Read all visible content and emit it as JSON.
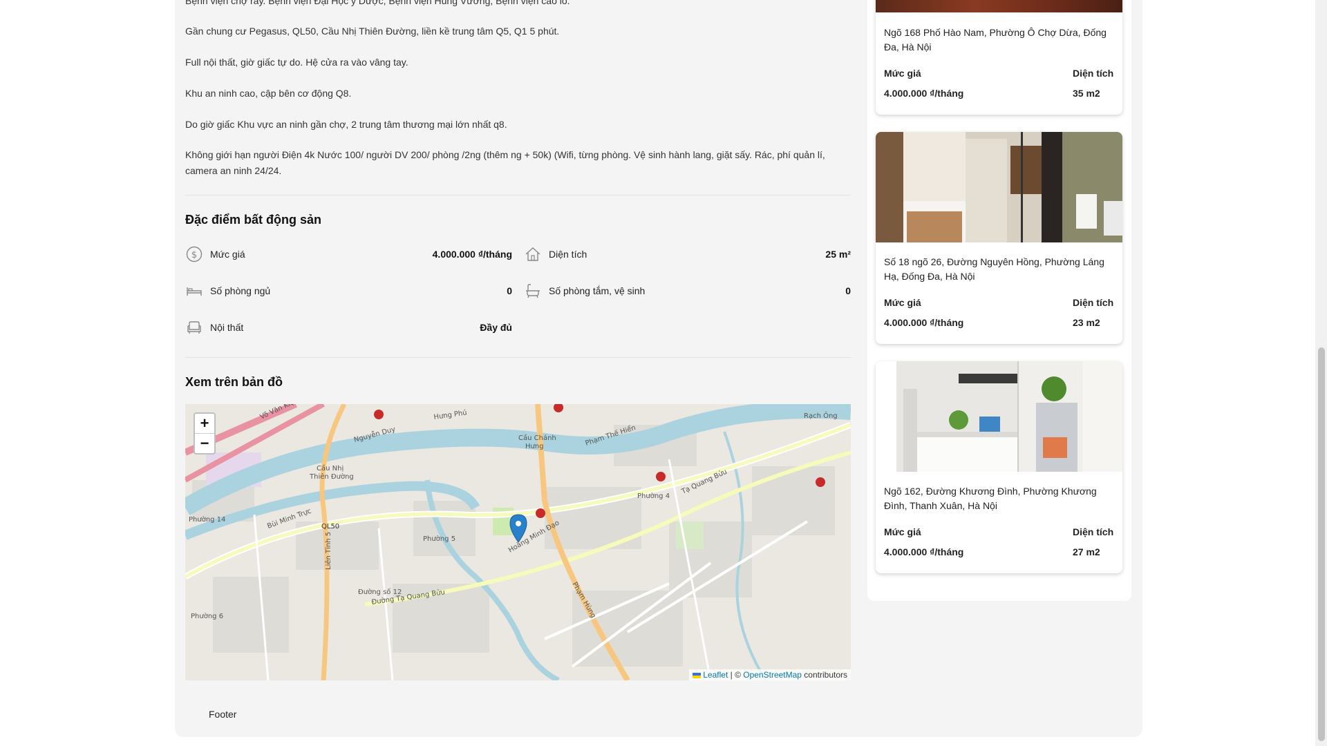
{
  "description": {
    "lines": [
      "Bệnh viện chợ rẫy. Bệnh viện Đại Học y Dược, Bệnh viện Hùng Vương, Bệnh viện cao lo.",
      "Gần chung cư Pegasus, QL50, Cầu Nhị Thiên Đường, liền kề trung tâm Q5, Q1 5 phút.",
      "Full nội thất, giờ giấc tự do. Hệ cửa ra vào vâng tay.",
      "Khu an ninh cao, cập bên cơ động Q8.",
      "Do giờ giấc Khu vực an ninh gần chợ, 2 trung tâm thương mại lớn nhất q8.",
      "Không giới hạn người Điện 4k Nước 100/ người DV 200/ phòng /2ng (thêm ng + 50k) (Wifi, từng phòng. Vệ sinh hành lang, giặt sấy. Rác, phí quản lí,",
      "camera an ninh 24/24."
    ]
  },
  "features": {
    "title": "Đặc điểm bất động sản",
    "items": [
      {
        "icon": "dollar-icon",
        "label": "Mức giá",
        "value": "4.000.000 ₫/tháng"
      },
      {
        "icon": "house-icon",
        "label": "Diện tích",
        "value": "25 m²"
      },
      {
        "icon": "bed-icon",
        "label": "Số phòng ngủ",
        "value": "0"
      },
      {
        "icon": "bathtub-icon",
        "label": "Số phòng tắm, vệ sinh",
        "value": "0"
      },
      {
        "icon": "sofa-icon",
        "label": "Nội thất",
        "value": "Đầy đủ"
      }
    ]
  },
  "map": {
    "title": "Xem trên bản đồ",
    "zoom_in": "+",
    "zoom_out": "−",
    "attribution_leaflet": "Leaflet",
    "attribution_sep": " | © ",
    "attribution_osm": "OpenStreetMap",
    "attribution_tail": " contributors",
    "labels": [
      "Võ Văn Kiệt",
      "Hưng Phú",
      "Cầu Chánh Hưng",
      "Nguyễn Duy",
      "Phạm Thế Hiển",
      "Cầu Nhị Thiên Đường",
      "QL50",
      "Phường 5",
      "Phường 4",
      "Đường Tạ Quang Bửu",
      "Tạ Quang Bửu",
      "Phạm Hùng",
      "Phường 6",
      "Rạch Ông",
      "Bùi Minh Trực",
      "Liên Tỉnh 5",
      "Hoàng Minh Đạo",
      "Phường 14",
      "Đường số 12"
    ]
  },
  "footer": {
    "text": "Footer"
  },
  "sidebar": {
    "cards": [
      {
        "address": "Ngõ 168 Phố Hào Nam, Phường Ô Chợ Dừa, Đống Đa, Hà Nội",
        "price_label": "Mức giá",
        "area_label": "Diện tích",
        "price": "4.000.000 ₫/tháng",
        "area": "35 m2"
      },
      {
        "address": "Số 18 ngõ 26, Đường Nguyên Hồng, Phường Láng Hạ, Đống Đa, Hà Nội",
        "price_label": "Mức giá",
        "area_label": "Diện tích",
        "price": "4.000.000 ₫/tháng",
        "area": "23 m2"
      },
      {
        "address": "Ngõ 162, Đường Khương Đình, Phường Khương Đình, Thanh Xuân, Hà Nội",
        "price_label": "Mức giá",
        "area_label": "Diện tích",
        "price": "4.000.000 ₫/tháng",
        "area": "27 m2"
      }
    ]
  },
  "colors": {
    "accent": "#1e78c8",
    "map_river": "#aad3df",
    "road_major": "#f8c77f"
  }
}
